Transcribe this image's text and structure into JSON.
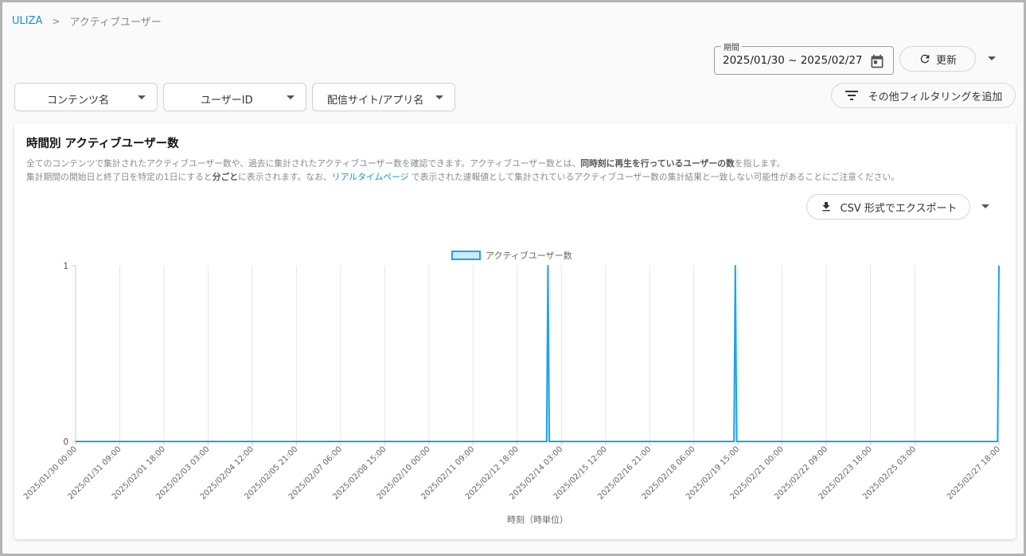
{
  "breadcrumb": {
    "root": "ULIZA",
    "separator": ">",
    "current": "アクティブユーザー"
  },
  "period": {
    "label": "期間",
    "value": "2025/01/30 ~ 2025/02/27"
  },
  "toolbar": {
    "refresh_label": "更新",
    "add_filter_label": "その他フィルタリングを追加"
  },
  "filters": {
    "content_name": "コンテンツ名",
    "user_id": "ユーザーID",
    "site_app": "配信サイト/アプリ名"
  },
  "card": {
    "title": "時間別 アクティブユーザー数",
    "desc1_a": "全てのコンテンツで集計されたアクティブユーザー数や、過去に集計されたアクティブユーザー数を確認できます。アクティブユーザー数とは、",
    "desc1_b": "同時刻に再生を行っているユーザーの数",
    "desc1_c": "を指します。",
    "desc2_a": "集計期間の開始日と終了日を特定の1日にすると",
    "desc2_b": "分ごと",
    "desc2_c": "に表示されます。なお、",
    "desc2_link": "リアルタイムページ",
    "desc2_d": " で表示された速報値として集計されているアクティブユーザー数の集計結果と一致しない可能性があることにご注意ください。",
    "csv_label": "CSV 形式でエクスポート"
  },
  "colors": {
    "accent": "#1a8fd9",
    "series": "#1fa3e8",
    "series_fill": "#cfe9f9"
  },
  "chart_data": {
    "type": "line",
    "xlabel": "時刻（時単位）",
    "ylabel": "",
    "ylim": [
      0,
      1
    ],
    "y_ticks": [
      "0",
      "1"
    ],
    "x_ticks": [
      "2025/01/30 00:00",
      "2025/01/31 09:00",
      "2025/02/01 18:00",
      "2025/02/03 03:00",
      "2025/02/04 12:00",
      "2025/02/05 21:00",
      "2025/02/07 06:00",
      "2025/02/08 15:00",
      "2025/02/10 00:00",
      "2025/02/11 09:00",
      "2025/02/12 18:00",
      "2025/02/14 03:00",
      "2025/02/15 12:00",
      "2025/02/16 21:00",
      "2025/02/18 06:00",
      "2025/02/19 15:00",
      "2025/02/21 00:00",
      "2025/02/22 09:00",
      "2025/02/23 18:00",
      "2025/02/25 03:00",
      "2025/02/27 18:00"
    ],
    "x_start": "2025/01/30 00:00",
    "x_end": "2025/02/27 18:00",
    "grid": true,
    "legend_position": "top",
    "series": [
      {
        "name": "アクティブユーザー数",
        "points": [
          {
            "x": "2025/01/30 00:00",
            "y": 0
          },
          {
            "x": "2025/02/13 16:00",
            "y": 0
          },
          {
            "x": "2025/02/13 17:00",
            "y": 1
          },
          {
            "x": "2025/02/13 18:00",
            "y": 0
          },
          {
            "x": "2025/02/19 12:00",
            "y": 0
          },
          {
            "x": "2025/02/19 13:00",
            "y": 1
          },
          {
            "x": "2025/02/19 14:00",
            "y": 0
          },
          {
            "x": "2025/02/27 17:00",
            "y": 0
          },
          {
            "x": "2025/02/27 18:00",
            "y": 1
          }
        ]
      }
    ]
  }
}
